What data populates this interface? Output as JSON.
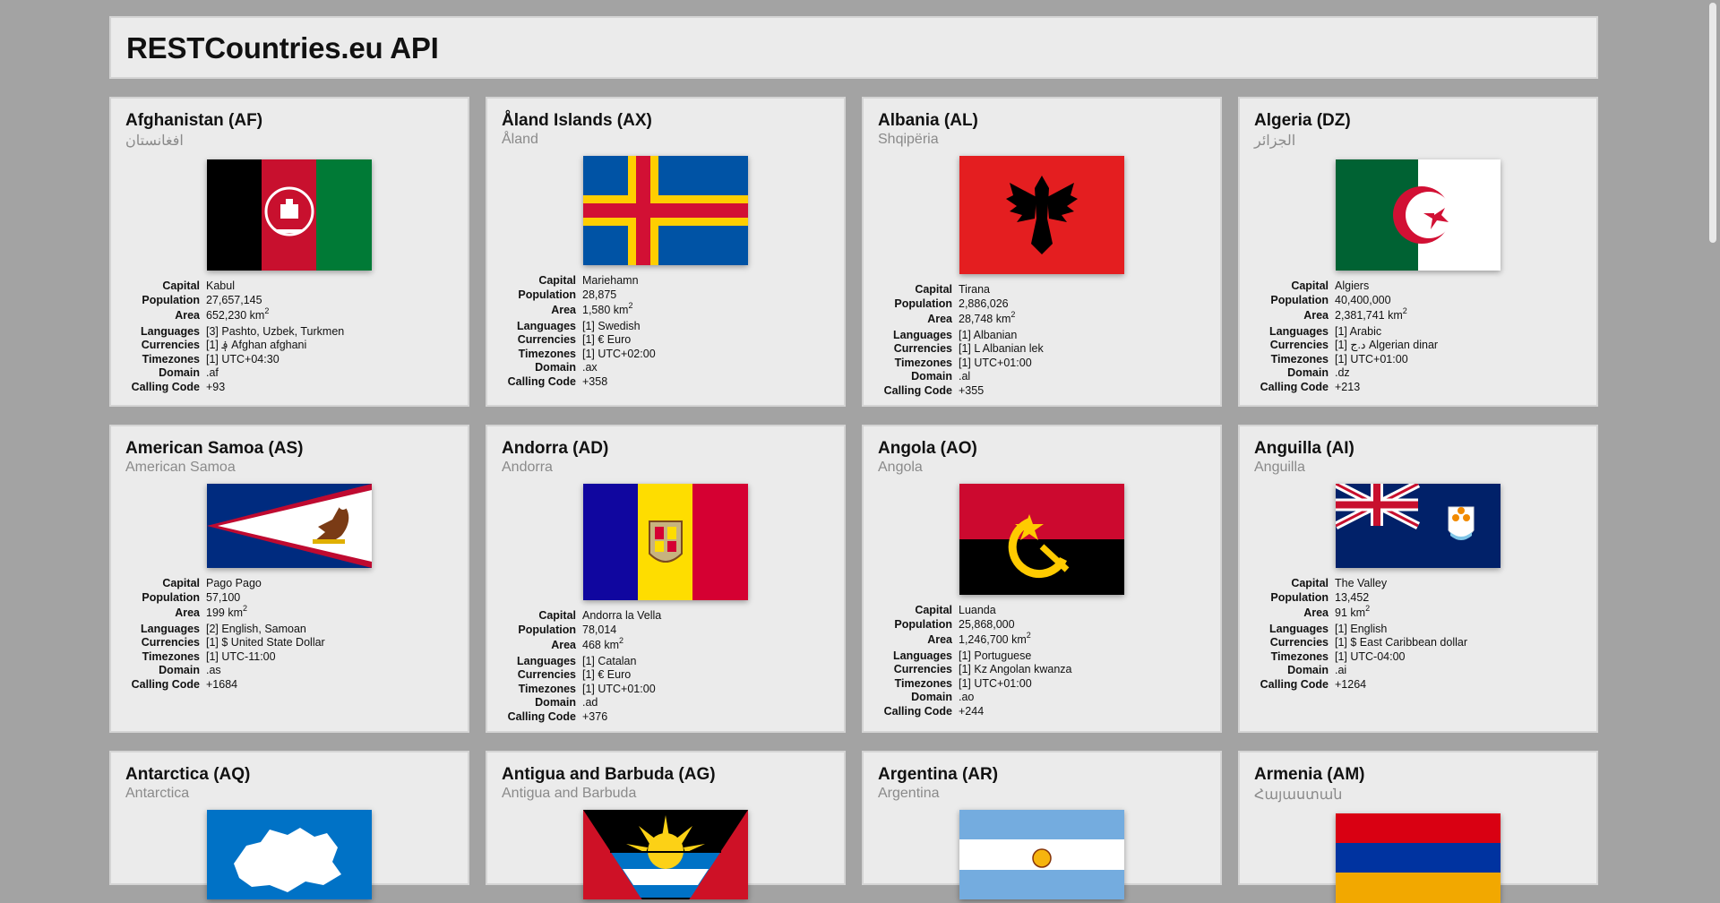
{
  "header": {
    "title": "RESTCountries.eu API"
  },
  "labels": {
    "capital": "Capital",
    "population": "Population",
    "area": "Area",
    "languages": "Languages",
    "currencies": "Currencies",
    "timezones": "Timezones",
    "domain": "Domain",
    "calling_code": "Calling Code",
    "area_unit": "km",
    "area_exp": "2"
  },
  "countries": [
    {
      "title": "Afghanistan (AF)",
      "native": "افغانستان",
      "capital": "Kabul",
      "population": "27,657,145",
      "area": "652,230",
      "languages": "[3] Pashto, Uzbek, Turkmen",
      "currencies": "[1] ؋ Afghan afghani",
      "timezones": "[1] UTC+04:30",
      "domain": ".af",
      "calling_code": "+93",
      "flag_icon": "afghanistan-flag-icon"
    },
    {
      "title": "Åland Islands (AX)",
      "native": "Åland",
      "capital": "Mariehamn",
      "population": "28,875",
      "area": "1,580",
      "languages": "[1] Swedish",
      "currencies": "[1] € Euro",
      "timezones": "[1] UTC+02:00",
      "domain": ".ax",
      "calling_code": "+358",
      "flag_icon": "aland-flag-icon"
    },
    {
      "title": "Albania (AL)",
      "native": "Shqipëria",
      "capital": "Tirana",
      "population": "2,886,026",
      "area": "28,748",
      "languages": "[1] Albanian",
      "currencies": "[1] L Albanian lek",
      "timezones": "[1] UTC+01:00",
      "domain": ".al",
      "calling_code": "+355",
      "flag_icon": "albania-flag-icon"
    },
    {
      "title": "Algeria (DZ)",
      "native": "الجزائر",
      "capital": "Algiers",
      "population": "40,400,000",
      "area": "2,381,741",
      "languages": "[1] Arabic",
      "currencies": "[1] د.ج Algerian dinar",
      "timezones": "[1] UTC+01:00",
      "domain": ".dz",
      "calling_code": "+213",
      "flag_icon": "algeria-flag-icon"
    },
    {
      "title": "American Samoa (AS)",
      "native": "American Samoa",
      "capital": "Pago Pago",
      "population": "57,100",
      "area": "199",
      "languages": "[2] English, Samoan",
      "currencies": "[1] $ United State Dollar",
      "timezones": "[1] UTC-11:00",
      "domain": ".as",
      "calling_code": "+1684",
      "flag_icon": "american-samoa-flag-icon"
    },
    {
      "title": "Andorra (AD)",
      "native": "Andorra",
      "capital": "Andorra la Vella",
      "population": "78,014",
      "area": "468",
      "languages": "[1] Catalan",
      "currencies": "[1] € Euro",
      "timezones": "[1] UTC+01:00",
      "domain": ".ad",
      "calling_code": "+376",
      "flag_icon": "andorra-flag-icon"
    },
    {
      "title": "Angola (AO)",
      "native": "Angola",
      "capital": "Luanda",
      "population": "25,868,000",
      "area": "1,246,700",
      "languages": "[1] Portuguese",
      "currencies": "[1] Kz Angolan kwanza",
      "timezones": "[1] UTC+01:00",
      "domain": ".ao",
      "calling_code": "+244",
      "flag_icon": "angola-flag-icon"
    },
    {
      "title": "Anguilla (AI)",
      "native": "Anguilla",
      "capital": "The Valley",
      "population": "13,452",
      "area": "91",
      "languages": "[1] English",
      "currencies": "[1] $ East Caribbean dollar",
      "timezones": "[1] UTC-04:00",
      "domain": ".ai",
      "calling_code": "+1264",
      "flag_icon": "anguilla-flag-icon"
    },
    {
      "title": "Antarctica (AQ)",
      "native": "Antarctica",
      "flag_icon": "antarctica-flag-icon"
    },
    {
      "title": "Antigua and Barbuda (AG)",
      "native": "Antigua and Barbuda",
      "flag_icon": "antigua-barbuda-flag-icon"
    },
    {
      "title": "Argentina (AR)",
      "native": "Argentina",
      "flag_icon": "argentina-flag-icon"
    },
    {
      "title": "Armenia (AM)",
      "native": "Հայաստան",
      "flag_icon": "armenia-flag-icon"
    }
  ]
}
